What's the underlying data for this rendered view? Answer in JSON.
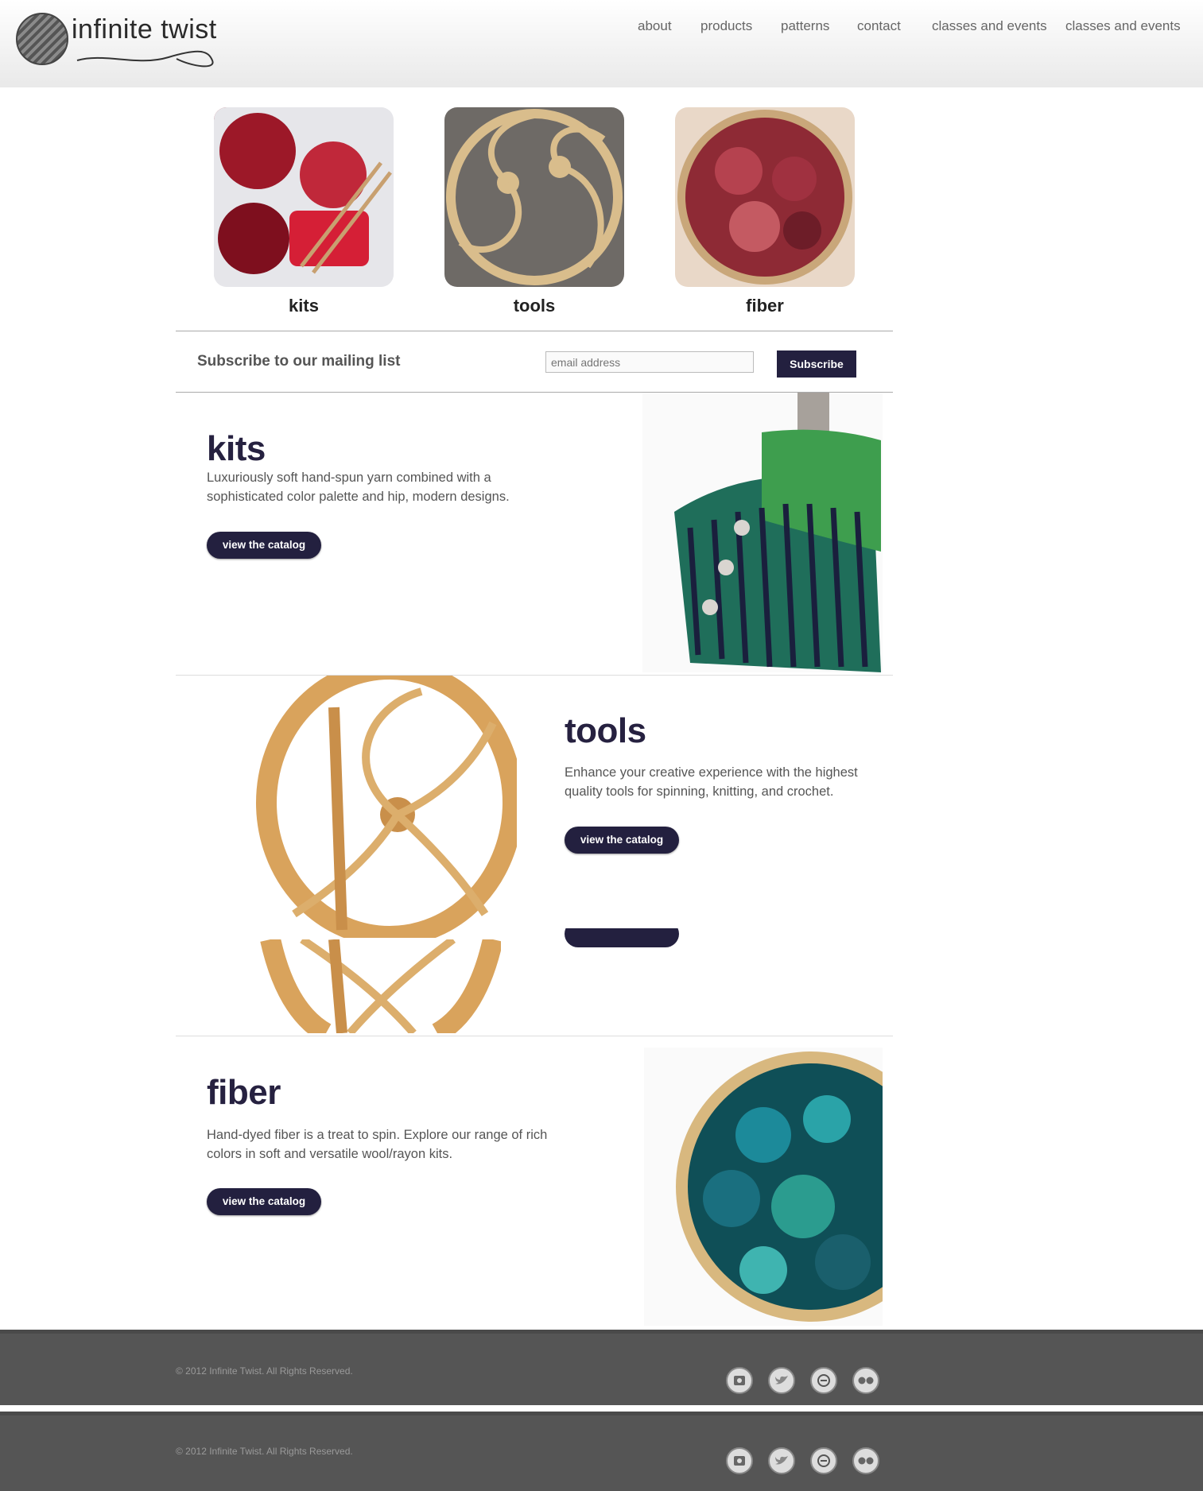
{
  "header": {
    "logo_text": "infinite twist",
    "nav": [
      "about",
      "products",
      "patterns",
      "contact",
      "classes and events",
      "classes and events"
    ]
  },
  "categories": [
    {
      "label": "kits"
    },
    {
      "label": "tools"
    },
    {
      "label": "fiber"
    }
  ],
  "subscribe": {
    "label": "Subscribe to our mailing list",
    "placeholder": "email address",
    "button": "Subscribe"
  },
  "sections": [
    {
      "title": "kits",
      "desc": "Luxuriously soft hand-spun yarn combined with a sophisticated color palette and hip, modern designs.",
      "button": "view the catalog"
    },
    {
      "title": "tools",
      "desc": "Enhance your creative experience with the highest quality tools for spinning, knitting, and crochet.",
      "button": "view the catalog"
    },
    {
      "title": "fiber",
      "desc": "Hand-dyed fiber is a treat to spin. Explore our range of rich colors in soft and versatile wool/rayon kits.",
      "button": "view the catalog"
    }
  ],
  "footer": {
    "copyright": "© 2012 Infinite Twist. All Rights Reserved.",
    "social_icons": [
      "instagram-icon",
      "twitter-icon",
      "etsy-icon",
      "flickr-icon"
    ]
  },
  "colors": {
    "accent": "#23203f",
    "footer_bg": "#555555"
  }
}
